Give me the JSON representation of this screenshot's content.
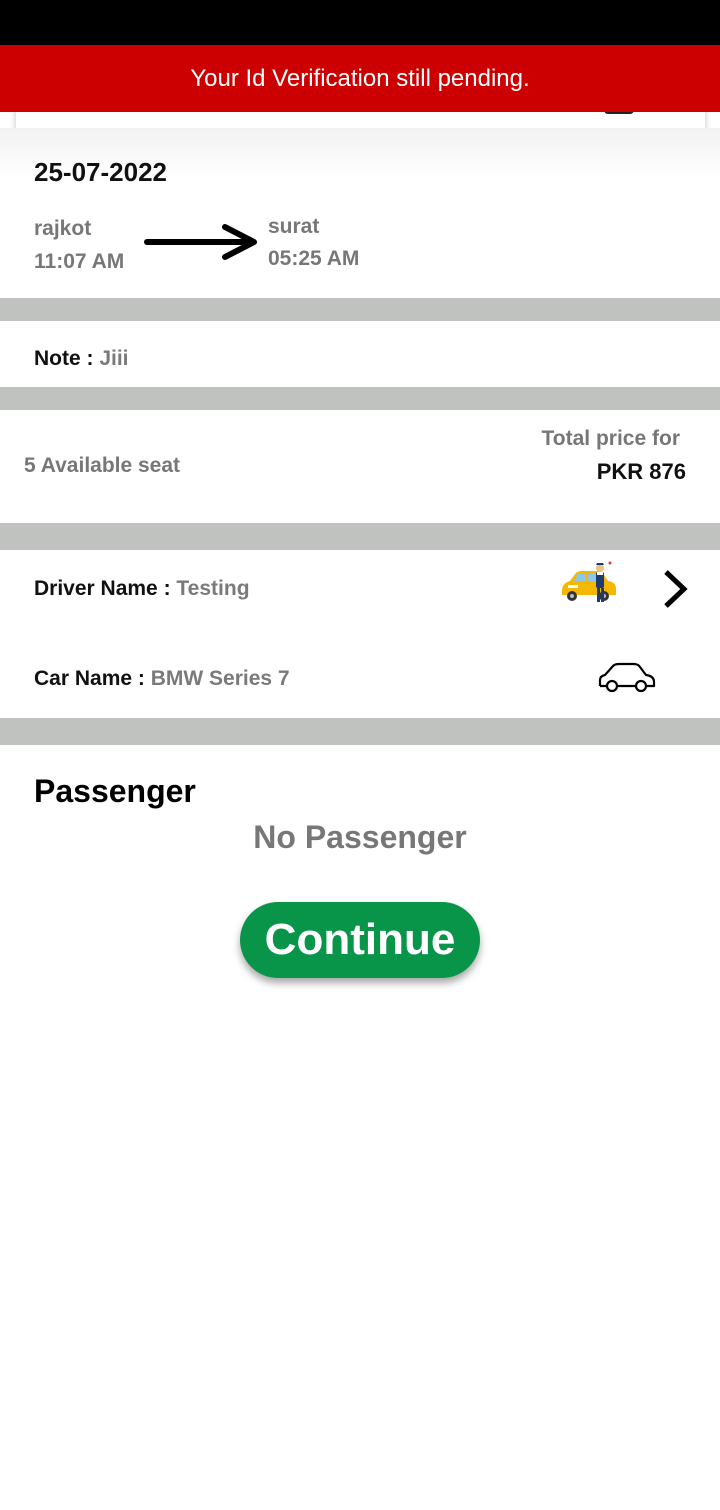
{
  "banner": {
    "message": "Your Id Verification still pending."
  },
  "trip": {
    "date": "25-07-2022",
    "from": {
      "city": "rajkot",
      "time": "11:07 AM"
    },
    "to": {
      "city": "surat",
      "time": "05:25 AM"
    }
  },
  "note": {
    "label": "Note : ",
    "value": "Jiii"
  },
  "seats": {
    "text": "5 Available seat"
  },
  "price": {
    "label": "Total price for",
    "value": "PKR 876"
  },
  "driver": {
    "label": "Driver Name : ",
    "value": "Testing"
  },
  "car": {
    "label": "Car Name : ",
    "value": "BMW Series 7"
  },
  "passengers": {
    "title": "Passenger",
    "empty_text": "No Passenger"
  },
  "actions": {
    "continue_label": "Continue"
  },
  "colors": {
    "banner_red": "#cc0000",
    "continue_green": "#08954a",
    "divider_gray": "#c0c2bf",
    "taxi_yellow": "#f5b800"
  },
  "icons": [
    "arrow-right-icon",
    "taxi-driver-icon",
    "chevron-right-icon",
    "car-outline-icon"
  ]
}
